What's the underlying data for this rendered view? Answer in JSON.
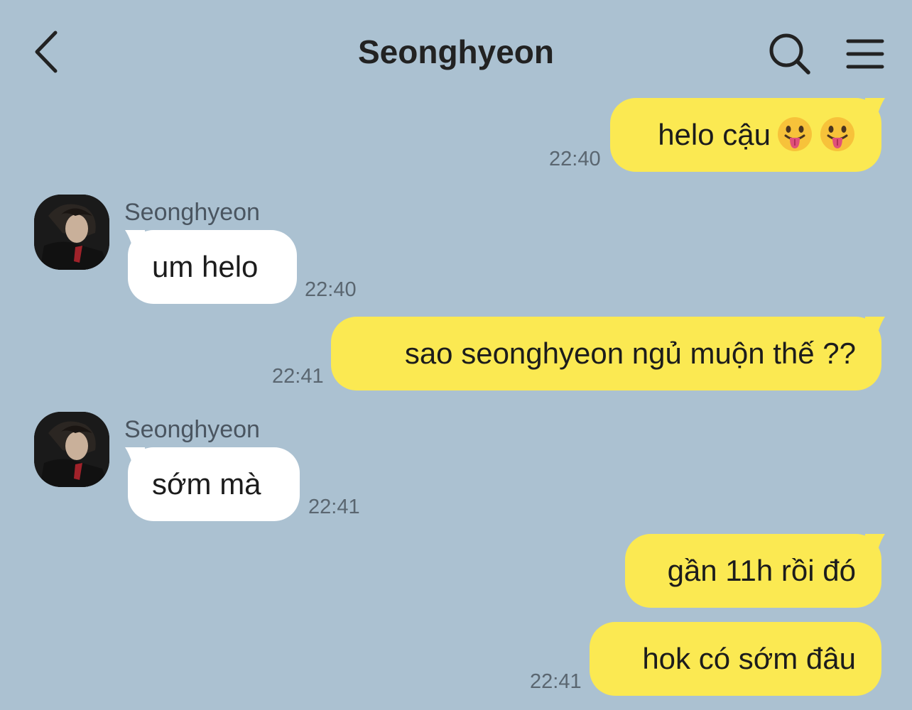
{
  "header": {
    "title": "Seonghyeon",
    "back_icon": "chevron-left-icon",
    "search_icon": "search-icon",
    "menu_icon": "menu-icon"
  },
  "colors": {
    "background": "#abc1d1",
    "outgoing_bubble": "#fbe952",
    "incoming_bubble": "#ffffff"
  },
  "messages": [
    {
      "direction": "outgoing",
      "text": "helo cậu",
      "emoji": [
        "tongue-face-icon",
        "tongue-face-icon"
      ],
      "time": "22:40"
    },
    {
      "direction": "incoming",
      "sender": "Seonghyeon",
      "text": "um helo",
      "time": "22:40"
    },
    {
      "direction": "outgoing",
      "text": "sao seonghyeon ngủ muộn thế ??",
      "time": "22:41"
    },
    {
      "direction": "incoming",
      "sender": "Seonghyeon",
      "text": "sớm mà",
      "time": "22:41"
    },
    {
      "direction": "outgoing",
      "text": "gần 11h rồi đó",
      "time": ""
    },
    {
      "direction": "outgoing",
      "text": "hok có sớm đâu",
      "time": "22:41"
    }
  ]
}
